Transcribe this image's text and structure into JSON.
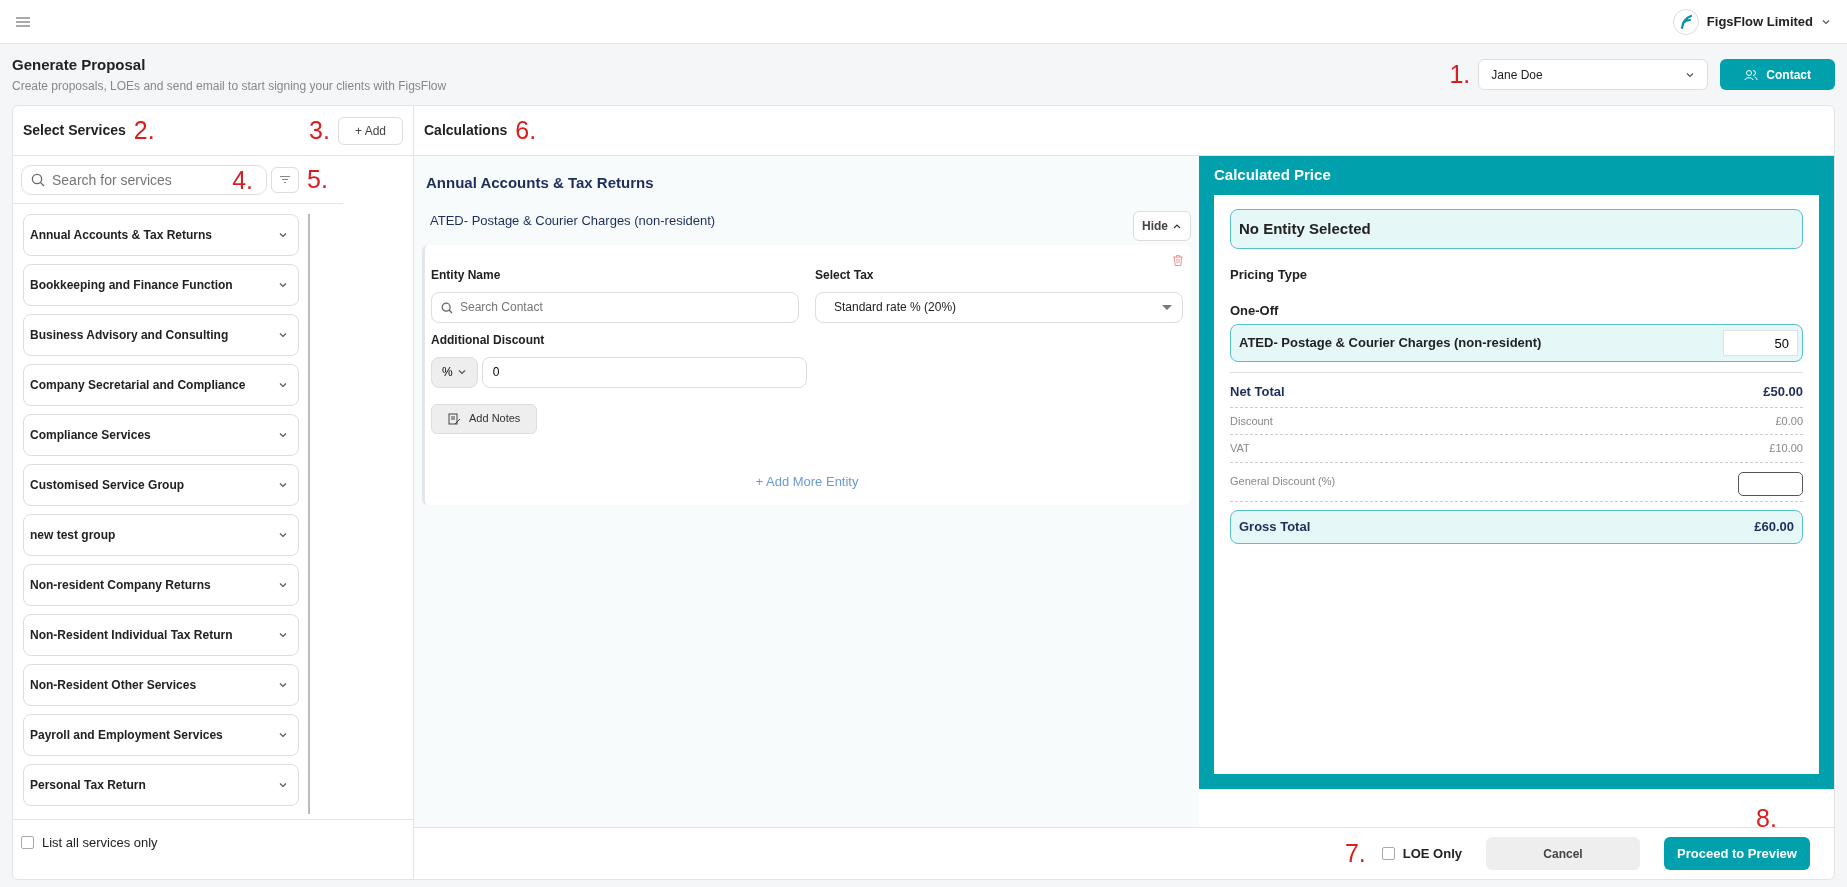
{
  "topbar": {
    "company": "FigsFlow Limited"
  },
  "header": {
    "title": "Generate Proposal",
    "subtitle": "Create proposals, LOEs and send email to start signing your clients with FigsFlow",
    "contact_select": {
      "value": "Jane Doe",
      "callout": "1."
    },
    "contact_button": "Contact"
  },
  "services_panel": {
    "title": "Select Services",
    "title_callout": "2.",
    "add_button": "+ Add",
    "add_callout": "3.",
    "search": {
      "placeholder": "Search for services",
      "callout": "4."
    },
    "filter_callout": "5.",
    "groups": [
      {
        "label": "Annual Accounts & Tax Returns",
        "expanded": false
      },
      {
        "label": "Bookkeeping and Finance Function",
        "expanded": false
      },
      {
        "label": "Business Advisory and Consulting",
        "expanded": false
      },
      {
        "label": "Company Secretarial and Compliance",
        "expanded": false
      },
      {
        "label": "Compliance Services",
        "expanded": false
      },
      {
        "label": "Customised Service Group",
        "expanded": false
      },
      {
        "label": "new test group",
        "expanded": false
      },
      {
        "label": "Non-resident Company Returns",
        "expanded": false
      },
      {
        "label": "Non-Resident Individual Tax Return",
        "expanded": false
      },
      {
        "label": "Non-Resident Other Services",
        "expanded": false
      },
      {
        "label": "Payroll and Employment Services",
        "expanded": false
      },
      {
        "label": "Personal Tax Return",
        "expanded": false
      }
    ],
    "list_all": {
      "label": "List all services only",
      "checked": false
    }
  },
  "calculations": {
    "title": "Calculations",
    "title_callout": "6.",
    "group_title": "Annual Accounts & Tax Returns",
    "service": {
      "name": "ATED- Postage & Courier Charges (non-resident)",
      "toggle": "Hide",
      "expanded": true
    },
    "entity": {
      "entity_label": "Entity Name",
      "entity_placeholder": "Search Contact",
      "tax_label": "Select Tax",
      "tax_value": "Standard rate % (20%)",
      "discount_label": "Additional Discount",
      "discount_unit": "%",
      "discount_value": "0",
      "notes_button": "Add Notes"
    },
    "add_entity": "+ Add More Entity"
  },
  "price_panel": {
    "title": "Calculated Price",
    "entity": "No Entity Selected",
    "pricing_type_label": "Pricing Type",
    "pricing_type": "One-Off",
    "items": [
      {
        "name": "ATED- Postage & Courier Charges (non-resident)",
        "price": "50"
      }
    ],
    "rows": [
      {
        "kind": "net",
        "label": "Net Total",
        "value": "£50.00"
      },
      {
        "kind": "minor",
        "label": "Discount",
        "value": "£0.00"
      },
      {
        "kind": "minor",
        "label": "VAT",
        "value": "£10.00"
      },
      {
        "kind": "input",
        "label": "General Discount (%)"
      }
    ],
    "gross": {
      "label": "Gross Total",
      "value": "£60.00"
    }
  },
  "footer": {
    "loe": {
      "label": "LOE Only",
      "checked": false,
      "callout": "7."
    },
    "cancel": "Cancel",
    "proceed": "Proceed to Preview",
    "proceed_callout": "8."
  }
}
